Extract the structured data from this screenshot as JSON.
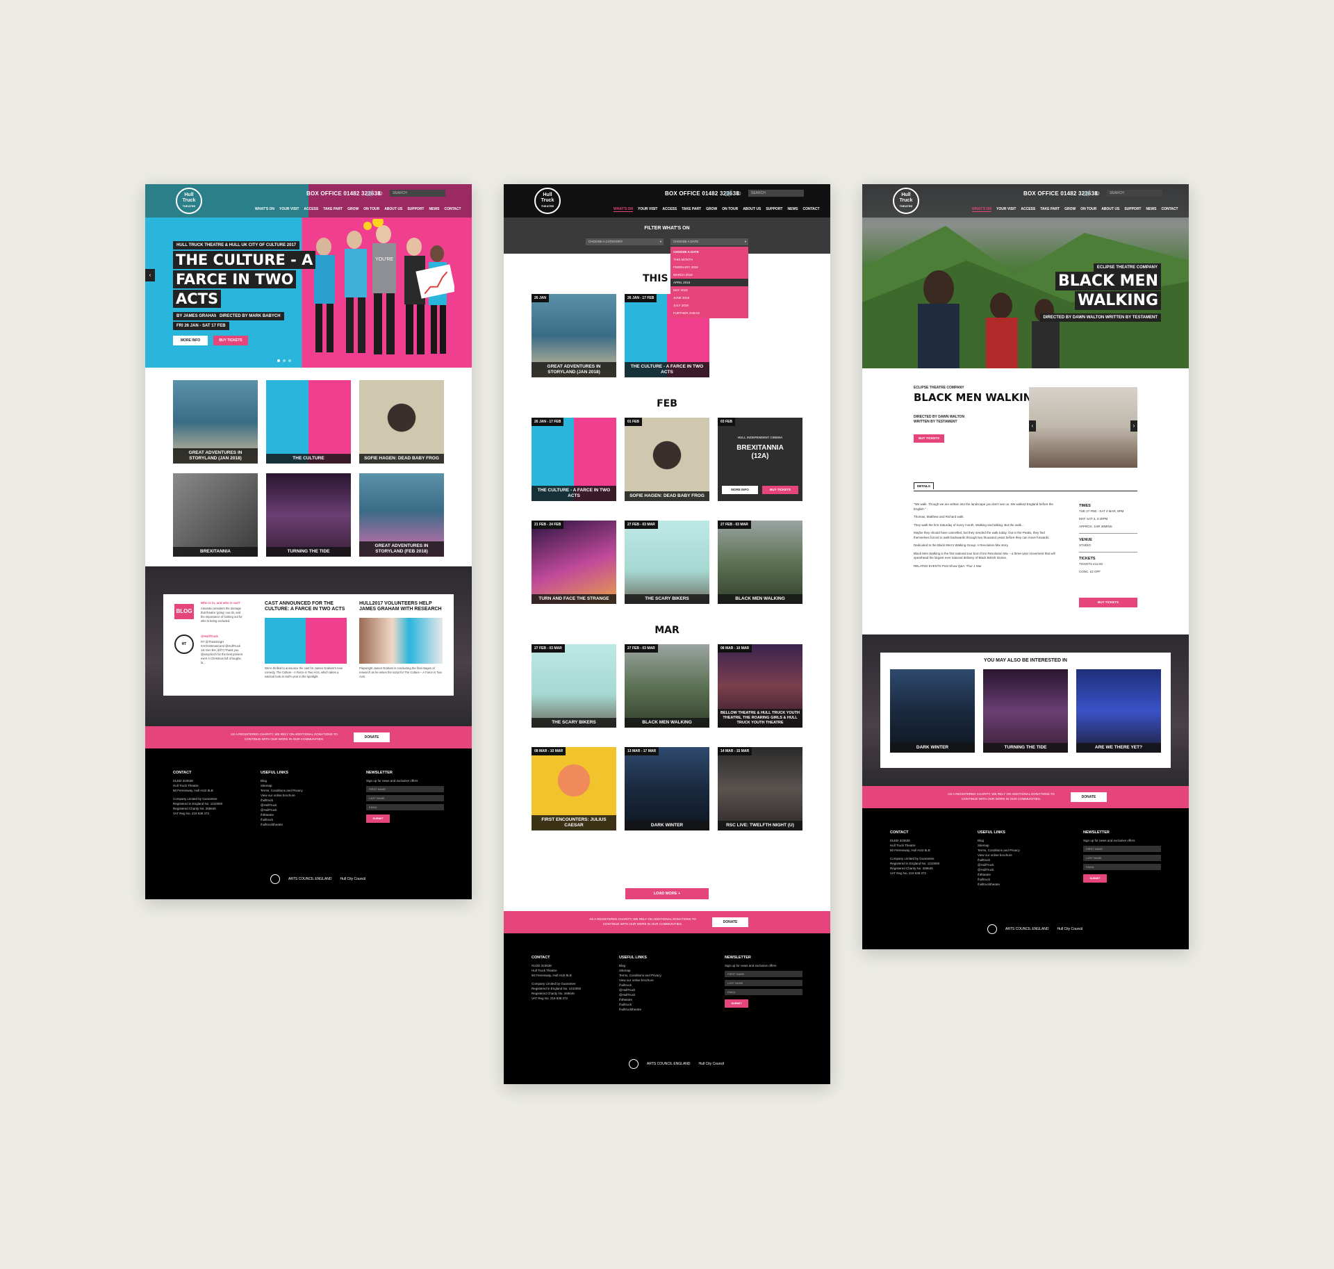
{
  "header": {
    "logo_top": "Hull",
    "logo_mid": "Truck",
    "logo_bot": "THEATRE",
    "box_office": "BOX OFFICE 01482 323638",
    "search_placeholder": "SEARCH",
    "nav": [
      "WHAT'S ON",
      "YOUR VISIT",
      "ACCESS",
      "TAKE PART",
      "GROW",
      "ON TOUR",
      "ABOUT US",
      "SUPPORT",
      "NEWS",
      "CONTACT"
    ]
  },
  "home": {
    "hero": {
      "kicker": "HULL TRUCK THEATRE & HULL UK CITY OF CULTURE 2017",
      "title_l1": "THE CULTURE - A",
      "title_l2": "FARCE IN TWO",
      "title_l3": "ACTS",
      "author": "BY JAMES GRAHAM",
      "director": "DIRECTED BY MARK BABYCH",
      "dates": "FRI 26 JAN - SAT 17 FEB",
      "more_info": "MORE INFO",
      "buy_tickets": "BUY TICKETS"
    },
    "tiles": [
      "GREAT ADVENTURES IN STORYLAND (JAN 2018)",
      "THE CULTURE",
      "SOFIE HAGEN: DEAD BABY FROG",
      "BREXITANNIA",
      "TURNING THE TIDE",
      "GREAT ADVENTURES IN STORYLAND (FEB 2018)"
    ],
    "news": {
      "blog_label": "BLOG",
      "blog_q": "Who is in, and who is out?",
      "blog_text": "Amanda considers the damage that theatre 'going' can do, and the importance of looking out for who is being excluded.",
      "twitter_handle": "@HullTruck",
      "tweet": "RT @ThisisSingH #AChristmasCarol @HullTruck 1st Gen BH, (it'll?) Thank you @amyclinch for the best present ever! A Christmas full of laughs, lo...",
      "article1_title": "CAST ANNOUNCED FOR THE CULTURE: A FARCE IN TWO ACTS",
      "article1_text": "We're thrilled to announce the cast for James Graham's new comedy, The Culture - A Farce in Two Acts, which takes a satirical look at Hull's year in the spotlight.",
      "article2_title": "HULL2017 VOLUNTEERS HELP JAMES GRAHAM WITH RESEARCH",
      "article2_text": "Playwright James Graham is conducting the final stages of research as he writes the script for The Culture – A Farce in Two Acts.",
      "more": "More info"
    }
  },
  "strip": {
    "text": "AS A REGISTERED CHARITY, WE RELY ON ADDITIONAL DONATIONS TO CONTINUE WITH OUR WORK IN OUR COMMUNITIES.",
    "donate": "DONATE"
  },
  "footer": {
    "contact_h": "CONTACT",
    "contact_lines": [
      "01482 323638",
      "Hull Truck Theatre",
      "50 Ferensway, Hull HU2 8LB",
      "",
      "Company Limited by Guarantee",
      "Registered in England No. 1210050",
      "Registered Charity No. 269645",
      "VAT Reg No. 219 938 372"
    ],
    "links_h": "USEFUL LINKS",
    "links": [
      "Blog",
      "Sitemap",
      "Terms, Conditions and Privacy",
      "View our online brochure",
      "/hulltruck",
      "@HullTruck",
      "@HullTruck",
      "/hthteatre",
      "/hulltruck",
      "/hulltrucktheatre"
    ],
    "news_h": "NEWSLETTER",
    "news_sub": "Sign up for news and exclusive offers",
    "first_name": "FIRST NAME",
    "last_name": "LAST NAME",
    "email": "EMAIL",
    "submit": "SUBMIT",
    "ace": "ARTS COUNCIL ENGLAND",
    "hull": "Hull City Council"
  },
  "whatson": {
    "filter_h": "FILTER WHAT'S ON",
    "category": "CHOOSE A CATEGORY",
    "date": "CHOOSE A DATE",
    "date_options": [
      "CHOOSE A DATE",
      "THIS MONTH",
      "FEBRUARY 2018",
      "MARCH 2018",
      "APRIL 2018",
      "MAY 2018",
      "JUNE 2018",
      "JULY 2018",
      "FURTHER AHEAD"
    ],
    "this_month": "THIS M",
    "feb": "FEB",
    "mar": "MAR",
    "load_more": "LOAD MORE +",
    "events": [
      {
        "date": "26 JAN",
        "title": "GREAT ADVENTURES IN STORYLAND (JAN 2018)"
      },
      {
        "date": "26 JAN - 17 FEB",
        "title": "THE CULTURE - A FARCE IN TWO ACTS"
      },
      {
        "date": "26 JAN - 17 FEB",
        "title": "THE CULTURE - A FARCE IN TWO ACTS"
      },
      {
        "date": "01 FEB",
        "title": "SOFIE HAGEN: DEAD BABY FROG"
      },
      {
        "date": "03 FEB",
        "title": "BREXITANNIA (12A)"
      },
      {
        "date": "21 FEB - 24 FEB",
        "title": "TURN AND FACE THE STRANGE"
      },
      {
        "date": "27 FEB - 03 MAR",
        "title": "THE SCARY BIKERS"
      },
      {
        "date": "27 FEB - 03 MAR",
        "title": "BLACK MEN WALKING"
      },
      {
        "date": "27 FEB - 03 MAR",
        "title": "THE SCARY BIKERS"
      },
      {
        "date": "27 FEB - 03 MAR",
        "title": "BLACK MEN WALKING"
      },
      {
        "date": "08 MAR - 10 MAR",
        "title": "BELLOW THEATRE & HULL TRUCK YOUTH THEATRE, THE ROARING GIRLS & HULL TRUCK YOUTH THEATRE"
      },
      {
        "date": "08 MAR - 10 MAR",
        "title": "FIRST ENCOUNTERS: JULIUS CAESAR"
      },
      {
        "date": "13 MAR - 17 MAR",
        "title": "DARK WINTER"
      },
      {
        "date": "14 MAR - 15 MAR",
        "title": "RSC LIVE: TWELFTH NIGHT (U)"
      }
    ],
    "brex_kicker": "HULL INDEPENDENT CINEMA",
    "more_info": "MORE INFO",
    "buy_tickets": "BUY TICKETS"
  },
  "show": {
    "kicker": "ECLIPSE THEATRE COMPANY",
    "title_l1": "BLACK MEN",
    "title_l2": "WALKING",
    "credit": "DIRECTED BY DAWN WALTON   WRITTEN BY TESTAMENT",
    "sub_kicker": "ECLIPSE THEATRE COMPANY",
    "sub_title": "BLACK MEN WALKING",
    "directed": "DIRECTED BY DAWN WALTON",
    "written": "WRITTEN BY TESTAMENT",
    "buy_tickets": "BUY TICKETS",
    "details_tab": "DETAILS",
    "body": [
      "\"We walk. Though we are written into the landscape you don't see us. We walked England before the English.\"",
      "Thomas, Matthew and Richard walk.",
      "They walk the first Saturday of every month. Walking and talking. But the walk...",
      "Maybe they should have cancelled, but they needed the walk today. Out in the Peaks, they find themselves forced to walk backwards through two thousand years before they can move forwards.",
      "Dedicated to the Black Men's Walking Group: A Revolution Mix story.",
      "Black Men Walking is the first national tour born from Revolution Mix – a three-year movement that will spearhead the largest ever national delivery of Black British stories.",
      "RELATED EVENTS Post Show Q&A: Thur 1 Mar"
    ],
    "times_h": "TIMES",
    "times": "TUE 27 FEB - SAT 3 MAR, 8PM",
    "times2": "MAT: SAT 3, 2:30PM",
    "duration": "APPROX. 1HR 30MINS",
    "venue_h": "VENUE",
    "venue": "STUDIO",
    "tickets_h": "TICKETS",
    "tickets": "TICKETS £12.50",
    "conc": "CONC. £2 OFF",
    "interested_h": "YOU MAY ALSO BE INTERESTED IN",
    "interested": [
      "DARK WINTER",
      "TURNING THE TIDE",
      "ARE WE THERE YET?"
    ]
  },
  "colors": {
    "pink": "#e5457b",
    "cyan": "#2ab5dc",
    "dark": "#1e1e1e"
  }
}
